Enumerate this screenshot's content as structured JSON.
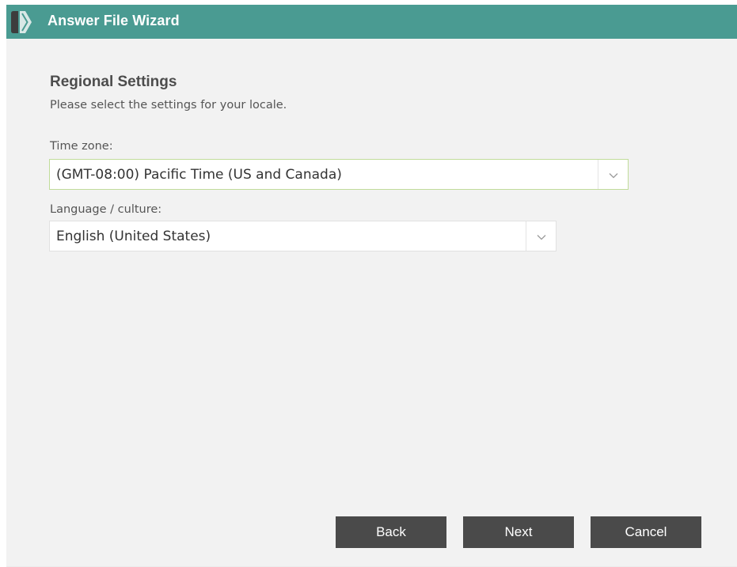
{
  "window": {
    "title": "Answer File Wizard",
    "accent_color": "#4a9b92",
    "app_icon": "wizard-chevron-icon"
  },
  "page": {
    "heading": "Regional Settings",
    "subheading": "Please select the settings for your locale."
  },
  "fields": {
    "time_zone": {
      "label": "Time zone:",
      "value": "(GMT-08:00) Pacific Time (US and Canada)",
      "icon": "chevron-down-icon"
    },
    "language": {
      "label": "Language / culture:",
      "value": "English (United States)",
      "icon": "chevron-down-icon"
    }
  },
  "buttons": {
    "back": "Back",
    "next": "Next",
    "cancel": "Cancel",
    "color": "#4a4a4a"
  }
}
